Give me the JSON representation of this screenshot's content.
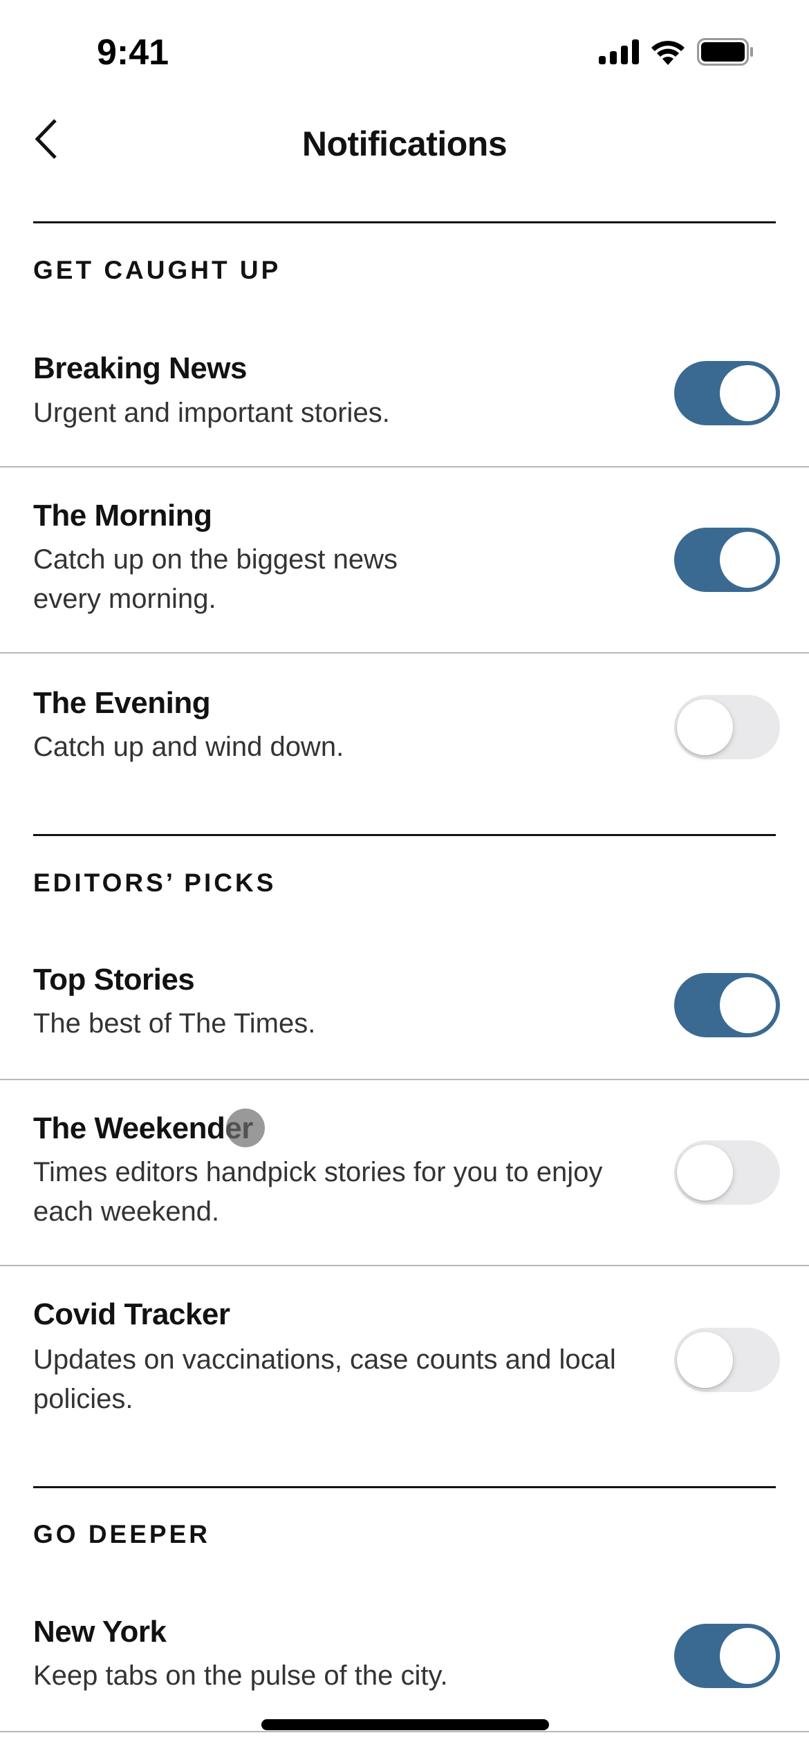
{
  "status_bar": {
    "time": "9:41",
    "icons": [
      "cellular-signal-icon",
      "wifi-icon",
      "battery-icon"
    ]
  },
  "nav": {
    "back_icon": "chevron-left-icon",
    "title": "Notifications"
  },
  "sections": [
    {
      "header": "GET CAUGHT UP",
      "items": [
        {
          "title": "Breaking News",
          "description": "Urgent and important stories.",
          "enabled": true
        },
        {
          "title": "The Morning",
          "description": "Catch up on the biggest news every morning.",
          "enabled": true
        },
        {
          "title": "The Evening",
          "description": "Catch up and wind down.",
          "enabled": false
        }
      ]
    },
    {
      "header": "EDITORS’ PICKS",
      "items": [
        {
          "title": "Top Stories",
          "description": "The best of The Times.",
          "enabled": true
        },
        {
          "title": "The Weekender",
          "description": "Times editors handpick stories for you to enjoy each weekend.",
          "enabled": false
        },
        {
          "title": "Covid Tracker",
          "description": "Updates on vaccinations, case counts and local policies.",
          "enabled": false
        }
      ]
    },
    {
      "header": "GO DEEPER",
      "items": [
        {
          "title": "New York",
          "description": "Keep tabs on the pulse of the city.",
          "enabled": true
        }
      ]
    }
  ],
  "colors": {
    "toggle_on": "#3a6a91",
    "toggle_off": "#e9e9eb",
    "text_primary": "#121212",
    "text_secondary": "#333333"
  }
}
